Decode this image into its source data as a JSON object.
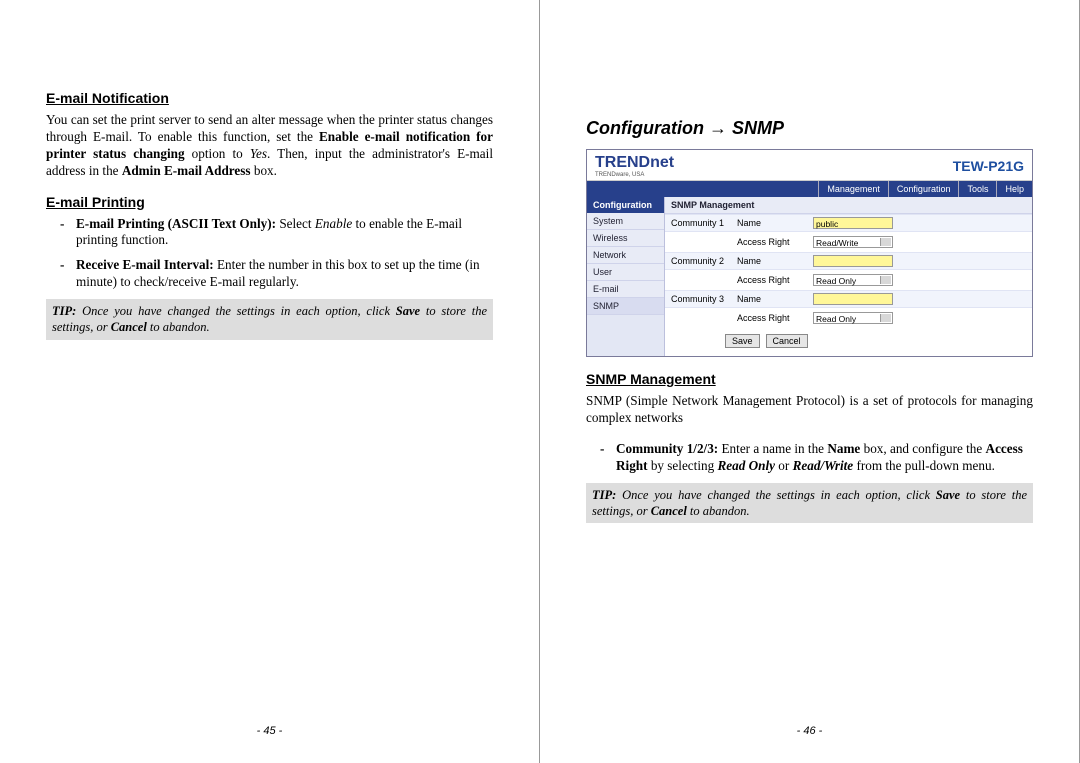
{
  "left": {
    "sec1_title": "E-mail Notification",
    "sec1_body_pre": "You can set the print server to send an alter message when the printer status changes through E-mail.  To enable this function, set the ",
    "sec1_body_bold1": "Enable e-mail notification for printer status changing",
    "sec1_body_mid1": " option to ",
    "sec1_body_ital1": "Yes",
    "sec1_body_mid2": ".    Then, input the administrator's E-mail address in the ",
    "sec1_body_bold2": "Admin E-mail Address",
    "sec1_body_end": " box.",
    "sec2_title": "E-mail Printing",
    "b1_bold": "E-mail Printing (ASCII Text Only):",
    "b1_rest_pre": " Select ",
    "b1_rest_ital": "Enable",
    "b1_rest_post": " to enable the E-mail printing function.",
    "b2_bold": "Receive E-mail Interval:",
    "b2_rest": " Enter the number in this box to set up the time (in minute) to check/receive E-mail regularly.",
    "tip_label": "TIP:",
    "tip_text_1": " Once you have changed the settings in each option, click ",
    "tip_save": "Save",
    "tip_text_2": " to store the settings, or ",
    "tip_cancel": "Cancel",
    "tip_text_3": " to abandon.",
    "page_num": "- 45 -"
  },
  "right": {
    "heading_pre": "Configuration ",
    "heading_arrow": "→",
    "heading_post": " SNMP",
    "shot": {
      "logo": "TRENDnet",
      "model": "TEW-P21G",
      "nav": [
        "Management",
        "Configuration",
        "Tools",
        "Help"
      ],
      "side_head": "Configuration",
      "side_items": [
        "System",
        "Wireless",
        "Network",
        "User",
        "E-mail",
        "SNMP"
      ],
      "panel_title": "SNMP Management",
      "rows": [
        {
          "g": "Community 1",
          "k": "Name",
          "v": "public",
          "type": "field"
        },
        {
          "g": "",
          "k": "Access Right",
          "v": "Read/Write",
          "type": "sel"
        },
        {
          "g": "Community 2",
          "k": "Name",
          "v": "",
          "type": "field"
        },
        {
          "g": "",
          "k": "Access Right",
          "v": "Read Only",
          "type": "sel"
        },
        {
          "g": "Community 3",
          "k": "Name",
          "v": "",
          "type": "field"
        },
        {
          "g": "",
          "k": "Access Right",
          "v": "Read Only",
          "type": "sel"
        }
      ],
      "btn_save": "Save",
      "btn_cancel": "Cancel"
    },
    "sec_title": "SNMP Management",
    "sec_body": "SNMP (Simple Network Management Protocol) is a set of protocols for managing complex networks",
    "b1_bold": "Community 1/2/3:",
    "b1_p1": " Enter a name in the ",
    "b1_b2": "Name",
    "b1_p2": " box, and configure the ",
    "b1_b3": "Access Right",
    "b1_p3": " by selecting ",
    "b1_i1": "Read Only",
    "b1_p4": " or ",
    "b1_i2": "Read/Write",
    "b1_p5": " from the pull-down menu.",
    "tip_label": "TIP:",
    "tip_text_1": " Once you have changed the settings in each option, click ",
    "tip_save": "Save",
    "tip_text_2": " to store the settings, or ",
    "tip_cancel": "Cancel",
    "tip_text_3": " to abandon.",
    "page_num": "- 46 -"
  }
}
